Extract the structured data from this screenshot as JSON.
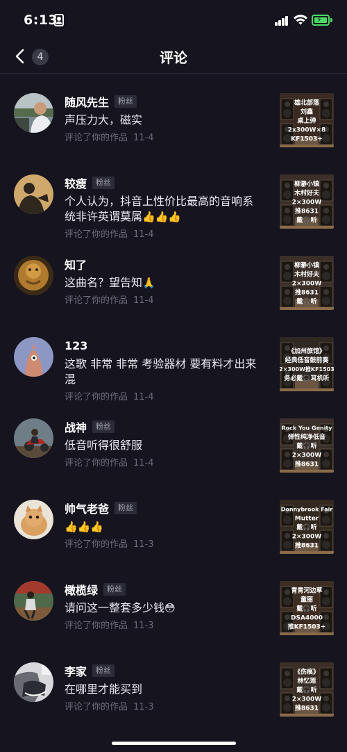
{
  "status_bar": {
    "time": "6:13"
  },
  "header": {
    "back_count": "4",
    "title": "评论"
  },
  "comments": [
    {
      "user": "随风先生",
      "tag": "粉丝",
      "text": "声压力大，磁实",
      "emojis": "",
      "action": "评论了你的作品",
      "date": "11-4",
      "thumb": {
        "bg": "#3a2a22",
        "lines": [
          "雄北部落",
          "刘鑫",
          "桌上弹",
          "2x300W×8",
          "KF1503+"
        ]
      }
    },
    {
      "user": "较瘦",
      "tag": "粉丝",
      "text": "个人认为，抖音上性价比最高的音响系统非许英谓莫属",
      "emojis": "👍👍👍",
      "action": "评论了你的作品",
      "date": "11-4",
      "thumb": {
        "bg": "#3b2f28",
        "lines": [
          "柳瀞小镇",
          "木村好夫",
          "2×300W",
          "推8631",
          "戴🎧听"
        ]
      }
    },
    {
      "user": "知了",
      "tag": "",
      "text": "这曲名？望告知",
      "emojis": "🙏",
      "action": "评论了你的作品",
      "date": "11-4",
      "thumb": {
        "bg": "#3b2f28",
        "lines": [
          "柳瀞小镇",
          "木村好夫",
          "2×300W",
          "推8631",
          "戴🎧听"
        ]
      }
    },
    {
      "user": "123",
      "tag": "",
      "text": "这歌 非常 非常 考验器材 要有料才出来混",
      "emojis": "",
      "action": "评论了你的作品",
      "date": "11-4",
      "thumb": {
        "bg": "#302823",
        "lines": [
          "《加州旅馆》",
          "经典低音鼓前奏",
          "2×300W推KF1503",
          "务必戴🎧耳机听"
        ]
      }
    },
    {
      "user": "战神",
      "tag": "粉丝",
      "text": "低音听得很舒服",
      "emojis": "",
      "action": "评论了你的作品",
      "date": "11-4",
      "thumb": {
        "bg": "#3a3029",
        "lines": [
          "Rock You Genity",
          "弹性纯净低音",
          "戴🎧听",
          "2×300W",
          "推8631"
        ]
      }
    },
    {
      "user": "帅气老爸",
      "tag": "粉丝",
      "text": "",
      "emojis": "👍👍👍",
      "action": "评论了你的作品",
      "date": "11-3",
      "thumb": {
        "bg": "#33291f",
        "lines": [
          "Donnybrook Fair",
          "Mutter",
          "戴🎧听",
          "2×300W",
          "推8631"
        ]
      }
    },
    {
      "user": "橄榄绿",
      "tag": "粉丝",
      "text": "请问这一整套多少钱",
      "emojis": "😳",
      "action": "评论了你的作品",
      "date": "11-3",
      "thumb": {
        "bg": "#3d2d22",
        "lines": [
          "青青河边草",
          "童丽",
          "戴🎧听",
          "DSA4000",
          "推KF1503+"
        ]
      }
    },
    {
      "user": "李家",
      "tag": "粉丝",
      "text": "在哪里才能买到",
      "emojis": "",
      "action": "评论了你的作品",
      "date": "11-3",
      "thumb": {
        "bg": "#3a2e26",
        "lines": [
          "《伤痕》",
          "林忆莲",
          "戴🎧听",
          "2×300W",
          "推8631"
        ]
      }
    }
  ]
}
